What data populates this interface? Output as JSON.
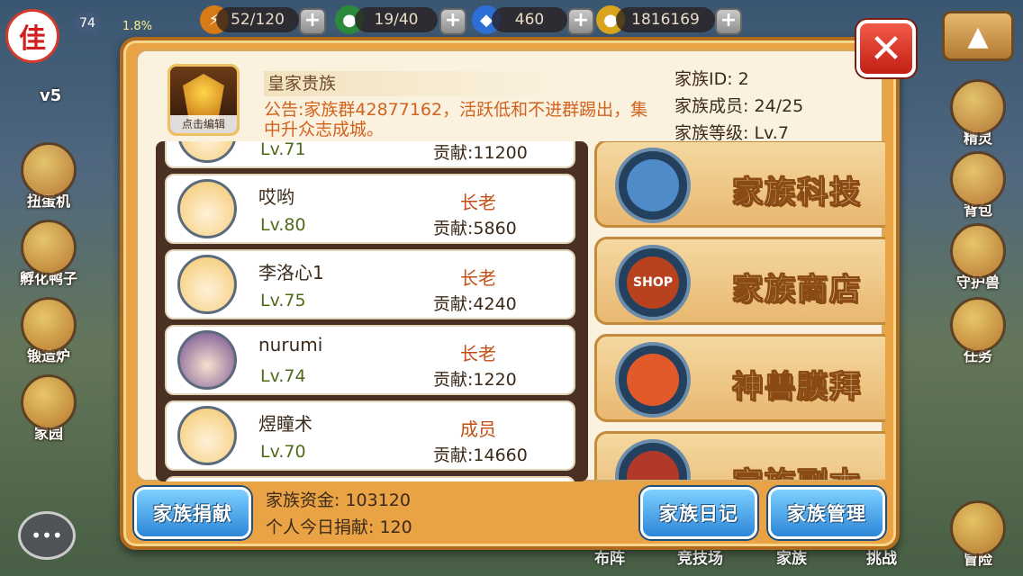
{
  "hud": {
    "player_initial": "佳",
    "player_level": "74",
    "exp_percent": "1.8%",
    "stamina": "52/120",
    "green_res": "19/40",
    "diamonds": "460",
    "gold": "1816169",
    "vip": "v5"
  },
  "left_menu": [
    "扭蛋机",
    "孵化鸭子",
    "锻造炉",
    "家园"
  ],
  "right_menu": [
    "精灵",
    "背包",
    "守护兽",
    "任务",
    "冒险"
  ],
  "bottom_tabs": [
    "布阵",
    "竞技场",
    "家族",
    "挑战"
  ],
  "family": {
    "emblem_edit_label": "点击编辑",
    "name": "皇家贵族",
    "notice": "公告:家族群42877162，活跃低和不进群踢出，集中升众志成城。",
    "id_label": "家族ID: 2",
    "members_label": "家族成员: 24/25",
    "level_label": "家族等级: Lv.7",
    "funds_label": "家族资金: 103120",
    "personal_donation_label": "个人今日捐献: 120"
  },
  "members": [
    {
      "name": "",
      "level": "Lv.71",
      "role": "",
      "contribution": "贡献:11200",
      "avatar": "blonde"
    },
    {
      "name": "哎哟",
      "level": "Lv.80",
      "role": "长老",
      "contribution": "贡献:5860",
      "avatar": "blonde"
    },
    {
      "name": "李洛心1",
      "level": "Lv.75",
      "role": "长老",
      "contribution": "贡献:4240",
      "avatar": "blonde"
    },
    {
      "name": "nurumi",
      "level": "Lv.74",
      "role": "长老",
      "contribution": "贡献:1220",
      "avatar": "purple"
    },
    {
      "name": "煜瞳术",
      "level": "Lv.70",
      "role": "成员",
      "contribution": "贡献:14660",
      "avatar": "blonde"
    }
  ],
  "features": [
    {
      "label": "家族科技",
      "icon": "book-icon",
      "color": "#4f8ac9"
    },
    {
      "label": "家族商店",
      "icon": "shop-icon",
      "color": "#b8421e"
    },
    {
      "label": "神兽膜拜",
      "icon": "helmet-icon",
      "color": "#e35a2a"
    },
    {
      "label": "家族副本",
      "icon": "dragon-icon",
      "color": "#b0392a"
    }
  ],
  "buttons": {
    "donate": "家族捐献",
    "diary": "家族日记",
    "manage": "家族管理",
    "close_glyph": "✕",
    "shop_badge": "SHOP",
    "up_glyph": "▲",
    "chat_glyph": "•••"
  }
}
